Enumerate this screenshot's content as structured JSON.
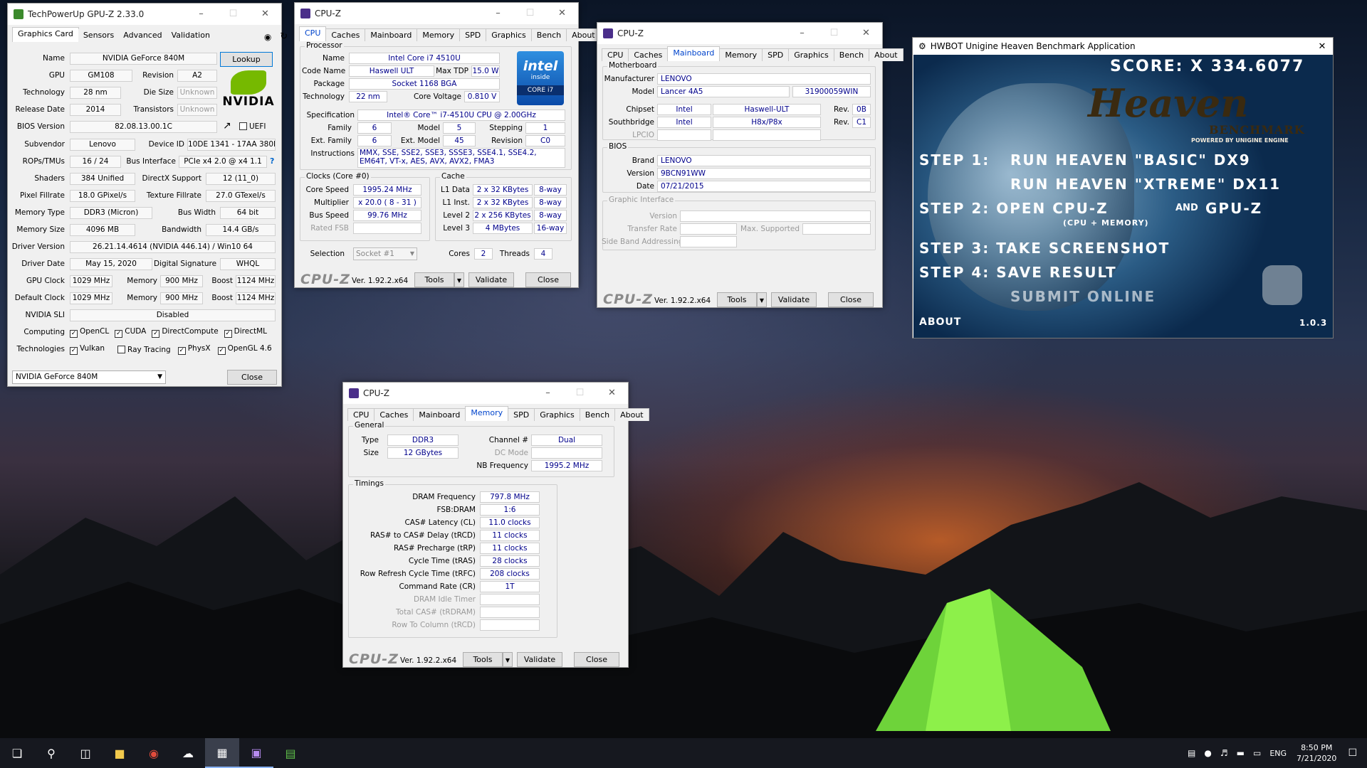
{
  "gpuz": {
    "title": "TechPowerUp GPU-Z 2.33.0",
    "tabs": [
      "Graphics Card",
      "Sensors",
      "Advanced",
      "Validation"
    ],
    "name_label": "Name",
    "name": "NVIDIA GeForce 840M",
    "lookup": "Lookup",
    "gpu_label": "GPU",
    "gpu": "GM108",
    "revision_label": "Revision",
    "revision": "A2",
    "tech_label": "Technology",
    "tech": "28 nm",
    "die_label": "Die Size",
    "die": "Unknown",
    "release_label": "Release Date",
    "release": "2014",
    "trans_label": "Transistors",
    "trans": "Unknown",
    "bios_label": "BIOS Version",
    "bios": "82.08.13.00.1C",
    "uefi": "UEFI",
    "subvendor_label": "Subvendor",
    "subvendor": "Lenovo",
    "devid_label": "Device ID",
    "devid": "10DE 1341 - 17AA 380D",
    "rops_label": "ROPs/TMUs",
    "rops": "16 / 24",
    "bus_label": "Bus Interface",
    "bus": "PCIe x4 2.0 @ x4 1.1",
    "bus_q": "?",
    "shaders_label": "Shaders",
    "shaders": "384 Unified",
    "dx_label": "DirectX Support",
    "dx": "12 (11_0)",
    "pix_label": "Pixel Fillrate",
    "pix": "18.0 GPixel/s",
    "tex_label": "Texture Fillrate",
    "tex": "27.0 GTexel/s",
    "memtype_label": "Memory Type",
    "memtype": "DDR3 (Micron)",
    "busw_label": "Bus Width",
    "busw": "64 bit",
    "memsize_label": "Memory Size",
    "memsize": "4096 MB",
    "bw_label": "Bandwidth",
    "bw": "14.4 GB/s",
    "driver_label": "Driver Version",
    "driver": "26.21.14.4614 (NVIDIA 446.14) / Win10 64",
    "ddate_label": "Driver Date",
    "ddate": "May 15, 2020",
    "dsig_label": "Digital Signature",
    "dsig": "WHQL",
    "gclk_label": "GPU Clock",
    "gclk": "1029 MHz",
    "mem_label": "Memory",
    "gmem": "900 MHz",
    "boost_label": "Boost",
    "gboost": "1124 MHz",
    "dclk_label": "Default Clock",
    "dclk": "1029 MHz",
    "dmem": "900 MHz",
    "dboost": "1124 MHz",
    "sli_label": "NVIDIA SLI",
    "sli": "Disabled",
    "computing_label": "Computing",
    "computing": [
      "OpenCL",
      "CUDA",
      "DirectCompute",
      "DirectML"
    ],
    "technologies_label": "Technologies",
    "technologies": [
      "Vulkan",
      "Ray Tracing",
      "PhysX",
      "OpenGL 4.6"
    ],
    "select": "NVIDIA GeForce 840M",
    "close": "Close",
    "logo": "NVIDIA"
  },
  "cpuz_cpu": {
    "title": "CPU-Z",
    "tabs": [
      "CPU",
      "Caches",
      "Mainboard",
      "Memory",
      "SPD",
      "Graphics",
      "Bench",
      "About"
    ],
    "processor": "Processor",
    "name_label": "Name",
    "name": "Intel Core i7 4510U",
    "code_label": "Code Name",
    "code": "Haswell ULT",
    "tdp_label": "Max TDP",
    "tdp": "15.0 W",
    "pkg_label": "Package",
    "pkg": "Socket 1168 BGA",
    "tech_label": "Technology",
    "tech": "22 nm",
    "volt_label": "Core Voltage",
    "volt": "0.810 V",
    "spec_label": "Specification",
    "spec": "Intel® Core™ i7-4510U CPU @ 2.00GHz",
    "fam_label": "Family",
    "fam": "6",
    "model_label": "Model",
    "model": "5",
    "step_label": "Stepping",
    "step": "1",
    "efam_label": "Ext. Family",
    "efam": "6",
    "emodel_label": "Ext. Model",
    "emodel": "45",
    "rev_label": "Revision",
    "rev": "C0",
    "instr_label": "Instructions",
    "instr": "MMX, SSE, SSE2, SSE3, SSSE3, SSE4.1, SSE4.2, EM64T, VT-x, AES, AVX, AVX2, FMA3",
    "clocks": "Clocks (Core #0)",
    "cache": "Cache",
    "cspeed_label": "Core Speed",
    "cspeed": "1995.24 MHz",
    "mult_label": "Multiplier",
    "mult": "x 20.0 ( 8 - 31 )",
    "bspeed_label": "Bus Speed",
    "bspeed": "99.76 MHz",
    "fsb_label": "Rated FSB",
    "l1d_label": "L1 Data",
    "l1d": "2 x 32 KBytes",
    "l1d_w": "8-way",
    "l1i_label": "L1 Inst.",
    "l1i": "2 x 32 KBytes",
    "l1i_w": "8-way",
    "l2_label": "Level 2",
    "l2": "2 x 256 KBytes",
    "l2_w": "8-way",
    "l3_label": "Level 3",
    "l3": "4 MBytes",
    "l3_w": "16-way",
    "sel_label": "Selection",
    "sel": "Socket #1",
    "cores_label": "Cores",
    "cores": "2",
    "threads_label": "Threads",
    "threads": "4",
    "intel_logo": "intel",
    "intel_inside": "inside",
    "intel_core": "CORE i7"
  },
  "cpuz_mb": {
    "title": "CPU-Z",
    "group": "Motherboard",
    "manu_label": "Manufacturer",
    "manu": "LENOVO",
    "model_label": "Model",
    "model": "Lancer 4A5",
    "model2": "31900059WIN",
    "chipset_label": "Chipset",
    "chipset": "Intel",
    "chipset2": "Haswell-ULT",
    "rev_label": "Rev.",
    "chipset_rev": "0B",
    "south_label": "Southbridge",
    "south": "Intel",
    "south2": "H8x/P8x",
    "south_rev": "C1",
    "lpcio_label": "LPCIO",
    "bios": "BIOS",
    "brand_label": "Brand",
    "brand": "LENOVO",
    "version_label": "Version",
    "version": "9BCN91WW",
    "date_label": "Date",
    "date": "07/21/2015",
    "gi": "Graphic Interface",
    "gi_ver": "Version",
    "gi_rate": "Transfer Rate",
    "gi_max": "Max. Supported",
    "gi_sba": "Side Band Addressing"
  },
  "cpuz_mem": {
    "title": "CPU-Z",
    "general": "General",
    "type_label": "Type",
    "type": "DDR3",
    "ch_label": "Channel #",
    "ch": "Dual",
    "size_label": "Size",
    "size": "12 GBytes",
    "dc_label": "DC Mode",
    "nb_label": "NB Frequency",
    "nb": "1995.2 MHz",
    "timings": "Timings",
    "rows": [
      {
        "label": "DRAM Frequency",
        "value": "797.8 MHz"
      },
      {
        "label": "FSB:DRAM",
        "value": "1:6"
      },
      {
        "label": "CAS# Latency (CL)",
        "value": "11.0 clocks"
      },
      {
        "label": "RAS# to CAS# Delay (tRCD)",
        "value": "11 clocks"
      },
      {
        "label": "RAS# Precharge (tRP)",
        "value": "11 clocks"
      },
      {
        "label": "Cycle Time (tRAS)",
        "value": "28 clocks"
      },
      {
        "label": "Row Refresh Cycle Time (tRFC)",
        "value": "208 clocks"
      },
      {
        "label": "Command Rate (CR)",
        "value": "1T"
      },
      {
        "label": "DRAM Idle Timer",
        "value": ""
      },
      {
        "label": "Total CAS# (tRDRAM)",
        "value": ""
      },
      {
        "label": "Row To Column (tRCD)",
        "value": ""
      }
    ]
  },
  "cpuz_common": {
    "logo": "CPU-Z",
    "version": "Ver. 1.92.2.x64",
    "tools": "Tools",
    "validate": "Validate",
    "close": "Close"
  },
  "heaven": {
    "title": "HWBOT Unigine Heaven Benchmark Application",
    "score": "SCORE: X 334.6077",
    "logo": "Heaven",
    "bench": "BENCHMARK",
    "powered": "POWERED BY UNIGINE ENGINE",
    "s1a": "STEP 1:",
    "s1b": "RUN HEAVEN \"BASIC\" DX9",
    "s1c": "RUN HEAVEN \"XTREME\" DX11",
    "s2a": "STEP 2: OPEN CPU-Z",
    "s2and": "AND",
    "s2b": "GPU-Z",
    "s2c": "(CPU + MEMORY)",
    "s3": "STEP 3: TAKE SCREENSHOT",
    "s4": "STEP 4: SAVE RESULT",
    "s5": "SUBMIT ONLINE",
    "about": "ABOUT",
    "ver": "1.0.3"
  },
  "taskbar": {
    "lang": "ENG",
    "time": "8:50 PM",
    "date": "7/21/2020"
  }
}
